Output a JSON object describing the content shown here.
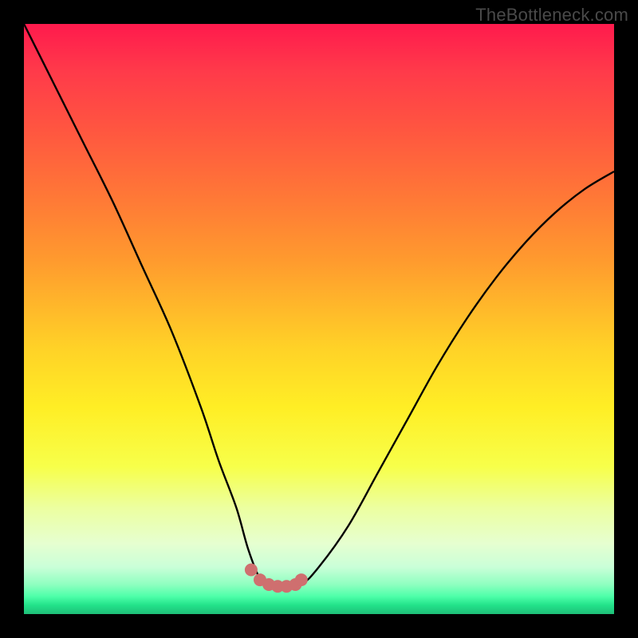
{
  "watermark": "TheBottleneck.com",
  "chart_data": {
    "type": "line",
    "title": "",
    "xlabel": "",
    "ylabel": "",
    "xlim": [
      0,
      100
    ],
    "ylim": [
      0,
      100
    ],
    "series": [
      {
        "name": "bottleneck-curve",
        "x": [
          0,
          5,
          10,
          15,
          20,
          25,
          30,
          33,
          36,
          38,
          40,
          42,
          44,
          47,
          50,
          55,
          60,
          65,
          70,
          75,
          80,
          85,
          90,
          95,
          100
        ],
        "values": [
          100,
          90,
          80,
          70,
          59,
          48,
          35,
          26,
          18,
          11,
          6,
          4.5,
          4.5,
          5,
          8,
          15,
          24,
          33,
          42,
          50,
          57,
          63,
          68,
          72,
          75
        ]
      },
      {
        "name": "bottom-dots",
        "x": [
          38.5,
          40.0,
          41.5,
          43.0,
          44.5,
          46.0,
          47.0
        ],
        "values": [
          7.5,
          5.8,
          5.0,
          4.7,
          4.7,
          5.0,
          5.8
        ]
      }
    ],
    "colors": {
      "curve": "#000000",
      "dots": "#cf6f6f"
    }
  }
}
